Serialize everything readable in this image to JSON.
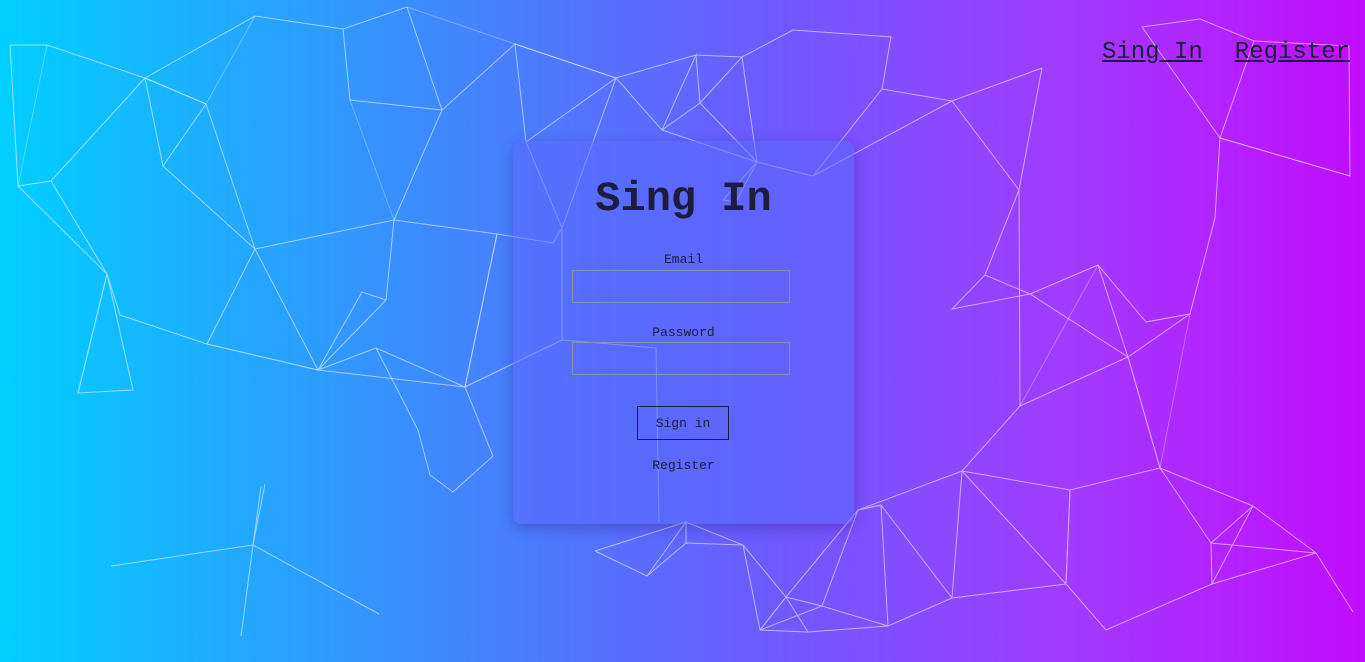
{
  "nav": {
    "signin_label": "Sing In",
    "register_label": "Register"
  },
  "form": {
    "title": "Sing In",
    "email_label": "Email",
    "email_value": "",
    "password_label": "Password",
    "password_value": "",
    "submit_label": "Sign in",
    "register_link": "Register"
  },
  "colors": {
    "gradient_start": "#00cfff",
    "gradient_end": "#c10cff",
    "text": "#1b1d3a",
    "lines": "#ffffff"
  }
}
